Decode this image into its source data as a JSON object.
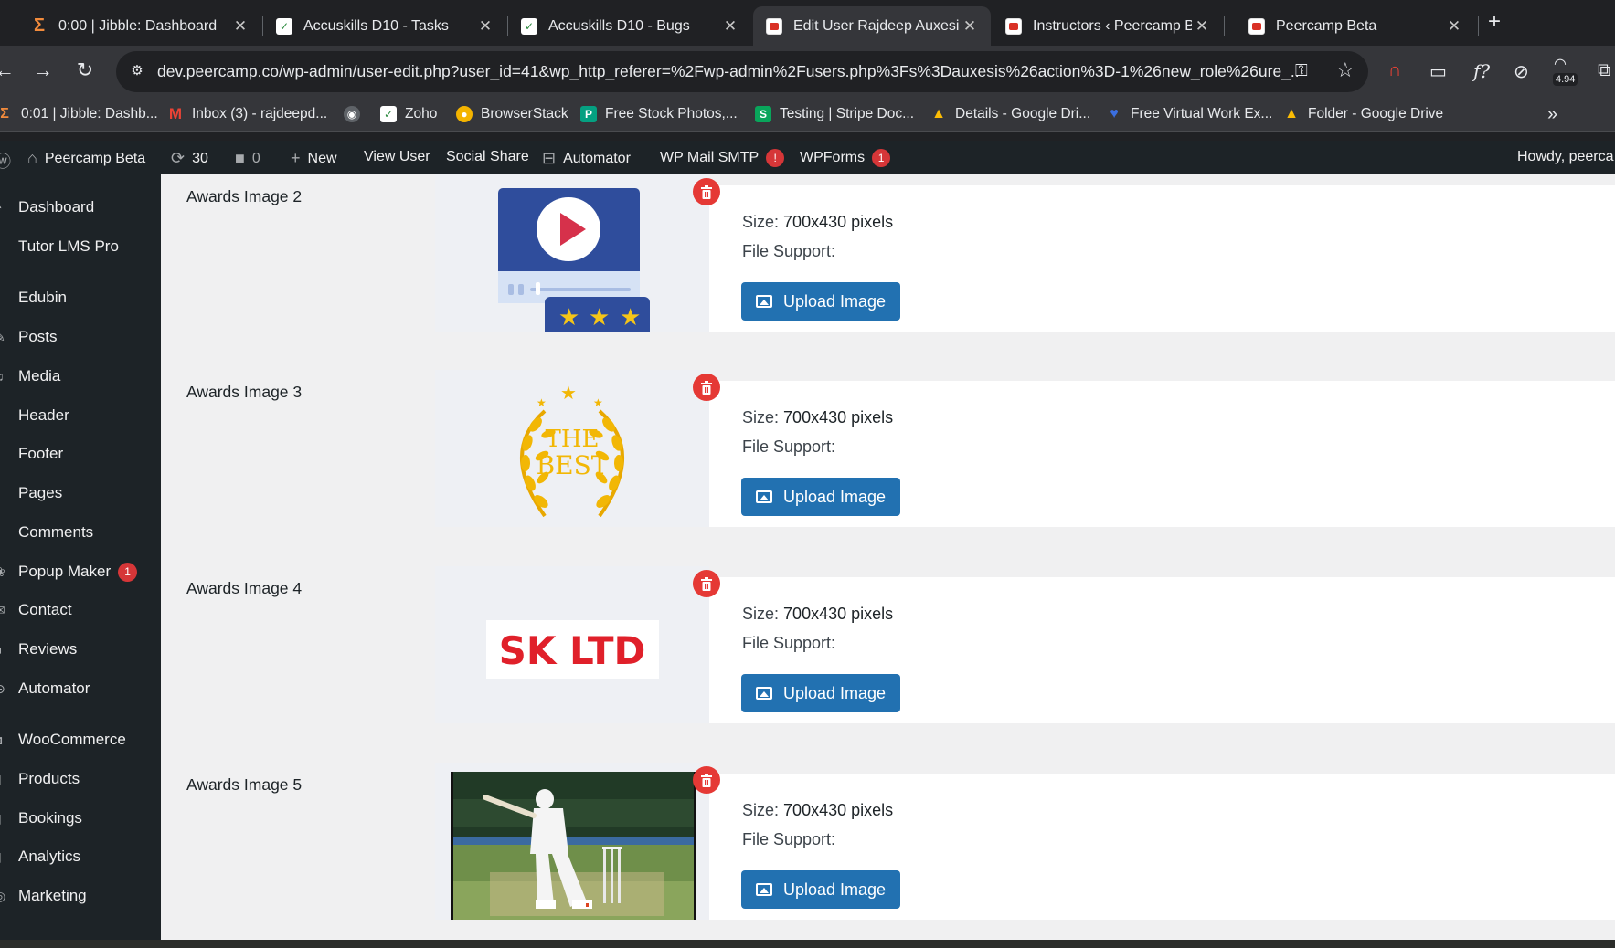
{
  "browser": {
    "tabs": [
      {
        "title": "0:00 | Jibble: Dashboard",
        "close": "✕"
      },
      {
        "title": "Accuskills D10 - Tasks",
        "close": "✕"
      },
      {
        "title": "Accuskills D10 - Bugs",
        "close": "✕"
      },
      {
        "title": "Edit User Rajdeep Auxesis",
        "close": "✕"
      },
      {
        "title": "Instructors ‹ Peercamp Beta",
        "close": "✕"
      },
      {
        "title": "Peercamp Beta",
        "close": "✕"
      }
    ],
    "new_tab": "+",
    "url": "dev.peercamp.co/wp-admin/user-edit.php?user_id=41&wp_http_referer=%2Fwp-admin%2Fusers.php%3Fs%3Dauxesis%26action%3D-1%26new_role%26ure_...",
    "extension_badge": "4.94",
    "bookmarks": [
      {
        "label": "0:01 | Jibble: Dashb...",
        "icon": "jibble-icon",
        "color": "#f28b3c"
      },
      {
        "label": "Inbox (3) - rajdeepd...",
        "icon": "gmail-icon",
        "color": "#ea4335"
      },
      {
        "label": "",
        "icon": "globe-icon",
        "color": "#5f6368"
      },
      {
        "label": "Zoho",
        "icon": "zoho-icon",
        "color": "#ffffff"
      },
      {
        "label": "BrowserStack",
        "icon": "browserstack-icon",
        "color": "#f4b400"
      },
      {
        "label": "Free Stock Photos,...",
        "icon": "pexels-icon",
        "color": "#05a081"
      },
      {
        "label": "Testing | Stripe Doc...",
        "icon": "stripe-icon",
        "color": "#09a55b"
      },
      {
        "label": "Details - Google Dri...",
        "icon": "gdrive-icon",
        "color": "#fbbc04"
      },
      {
        "label": "Free Virtual Work Ex...",
        "icon": "forage-icon",
        "color": "#3b6fe0"
      },
      {
        "label": "Folder - Google Drive",
        "icon": "gdrive-icon",
        "color": "#fbbc04"
      }
    ],
    "more": "»"
  },
  "adminbar": {
    "site": "Peercamp Beta",
    "updates": "30",
    "comments": "0",
    "new": "New",
    "view_user": "View User",
    "social_share": "Social Share",
    "automator": "Automator",
    "wp_mail_smtp": "WP Mail SMTP",
    "wp_mail_badge": "!",
    "wpforms": "WPForms",
    "wpforms_badge": "1",
    "howdy": "Howdy, peerca"
  },
  "sidebar": {
    "items": [
      {
        "label": "Dashboard"
      },
      {
        "label": "Tutor LMS Pro"
      },
      {
        "label": "Edubin"
      },
      {
        "label": "Posts"
      },
      {
        "label": "Media"
      },
      {
        "label": "Header"
      },
      {
        "label": "Footer"
      },
      {
        "label": "Pages"
      },
      {
        "label": "Comments"
      },
      {
        "label": "Popup Maker",
        "badge": "1"
      },
      {
        "label": "Contact"
      },
      {
        "label": "Reviews"
      },
      {
        "label": "Automator"
      },
      {
        "label": "WooCommerce"
      },
      {
        "label": "Products"
      },
      {
        "label": "Bookings"
      },
      {
        "label": "Analytics"
      },
      {
        "label": "Marketing"
      }
    ]
  },
  "awards": [
    {
      "label": "Awards Image 2",
      "size_label": "Size:",
      "size_value": "700x430 pixels",
      "support": "File Support:",
      "button": "Upload Image"
    },
    {
      "label": "Awards Image 3",
      "size_label": "Size:",
      "size_value": "700x430 pixels",
      "support": "File Support:",
      "button": "Upload Image",
      "thumb_text": [
        "THE",
        "BEST"
      ]
    },
    {
      "label": "Awards Image 4",
      "size_label": "Size:",
      "size_value": "700x430 pixels",
      "support": "File Support:",
      "button": "Upload Image",
      "thumb_text": [
        "SK LTD"
      ]
    },
    {
      "label": "Awards Image 5",
      "size_label": "Size:",
      "size_value": "700x430 pixels",
      "support": "File Support:",
      "button": "Upload Image"
    }
  ],
  "colors": {
    "wp_blue": "#2271b1",
    "delete_red": "#e53935",
    "admin_dark": "#1d2327",
    "badge_red": "#d63638"
  }
}
